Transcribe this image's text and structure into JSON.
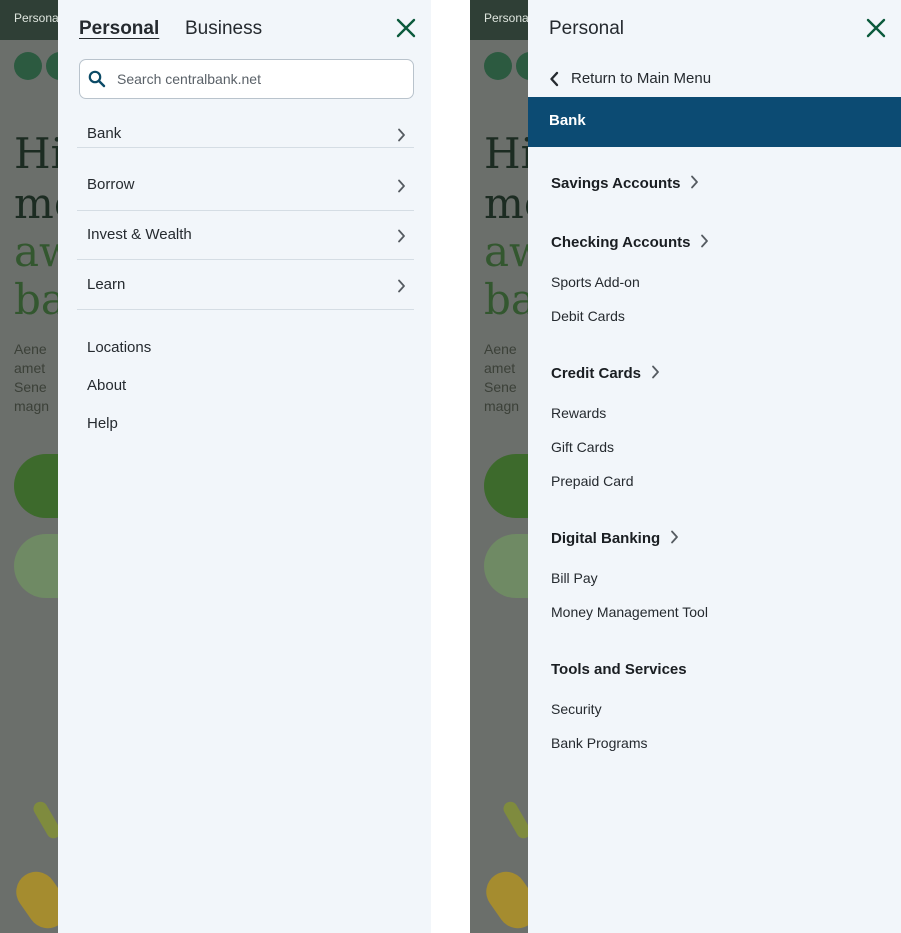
{
  "background_page": {
    "topbar_text": "Personal",
    "headline_lines": [
      "Hi",
      "mo",
      "aw",
      "ba"
    ],
    "paragraph_lines": [
      "Aene",
      "amet",
      "Sene",
      "magn"
    ]
  },
  "left_menu": {
    "tabs": [
      {
        "label": "Personal",
        "active": true
      },
      {
        "label": "Business",
        "active": false
      }
    ],
    "close_icon": "close-icon",
    "search": {
      "placeholder": "Search centralbank.net",
      "value": ""
    },
    "nav_items": [
      {
        "label": "Bank",
        "icon": "chevron-right-icon"
      },
      {
        "label": "Borrow",
        "icon": "chevron-right-icon"
      },
      {
        "label": "Invest & Wealth",
        "icon": "chevron-right-icon"
      },
      {
        "label": "Learn",
        "icon": "chevron-right-icon"
      }
    ],
    "utility_links": [
      "Locations",
      "About",
      "Help"
    ]
  },
  "right_menu": {
    "title": "Personal",
    "back_label": "Return to Main Menu",
    "current_section": "Bank",
    "sections": [
      {
        "title": "Savings Accounts",
        "has_chevron": true,
        "items": []
      },
      {
        "title": "Checking Accounts",
        "has_chevron": true,
        "items": [
          "Sports Add-on",
          "Debit Cards"
        ]
      },
      {
        "title": "Credit Cards",
        "has_chevron": true,
        "items": [
          "Rewards",
          "Gift Cards",
          "Prepaid Card"
        ]
      },
      {
        "title": "Digital Banking",
        "has_chevron": true,
        "items": [
          "Bill Pay",
          "Money Management Tool"
        ]
      },
      {
        "title": "Tools and Services",
        "has_chevron": false,
        "items": [
          "Security",
          "Bank Programs"
        ]
      }
    ]
  },
  "colors": {
    "panel_bg": "#f2f6fa",
    "accent_green": "#0b5a3c",
    "highlight_blue": "#0c4b73",
    "overlay_gray": "#6b6f6b"
  }
}
